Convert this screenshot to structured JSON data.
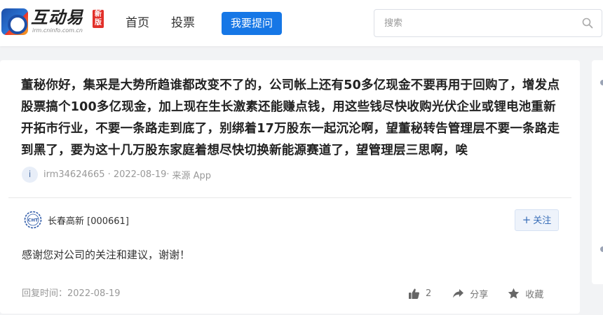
{
  "header": {
    "logo_text": "互动易",
    "logo_url": "irm.cninfo.com.cn",
    "logo_badge": "新版",
    "nav": [
      {
        "label": "首页"
      },
      {
        "label": "投票"
      }
    ],
    "ask_button": "我要提问",
    "search": {
      "placeholder": "搜索",
      "value": ""
    }
  },
  "question": {
    "text": "董秘你好，集采是大势所趋谁都改变不了的，公司帐上还有50多亿现金不要再用于回购了，增发点股票搞个100多亿现金，加上现在生长激素还能赚点钱，用这些钱尽快收购光伏企业或锂电池重新开拓市行业，不要一条路走到底了，别绑着17万股东一起沉沦啊，望董秘转告管理层不要一条路走到黑了，要为这十几万股东家庭着想尽快切换新能源赛道了，望管理层三思啊，唉",
    "user_avatar_letter": "i",
    "user": "irm34624665",
    "date": "· 2022-08-19·",
    "source": "来源 App"
  },
  "answer": {
    "company": "长春高新 [000661]",
    "company_logo_text": "CHT",
    "follow_label": "关注",
    "text": "感谢您对公司的关注和建议，谢谢！",
    "reply_time": "回复时间：2022-08-19",
    "likes": "2",
    "share_label": "分享",
    "favorite_label": "收藏"
  },
  "colors": {
    "accent": "#1677e6",
    "badge": "#e2302a",
    "meta_gray": "#999999"
  },
  "icons": {
    "search": "search-icon",
    "like": "thumbs-up-icon",
    "share": "share-arrow-icon",
    "favorite": "star-icon",
    "follow": "plus-icon"
  }
}
